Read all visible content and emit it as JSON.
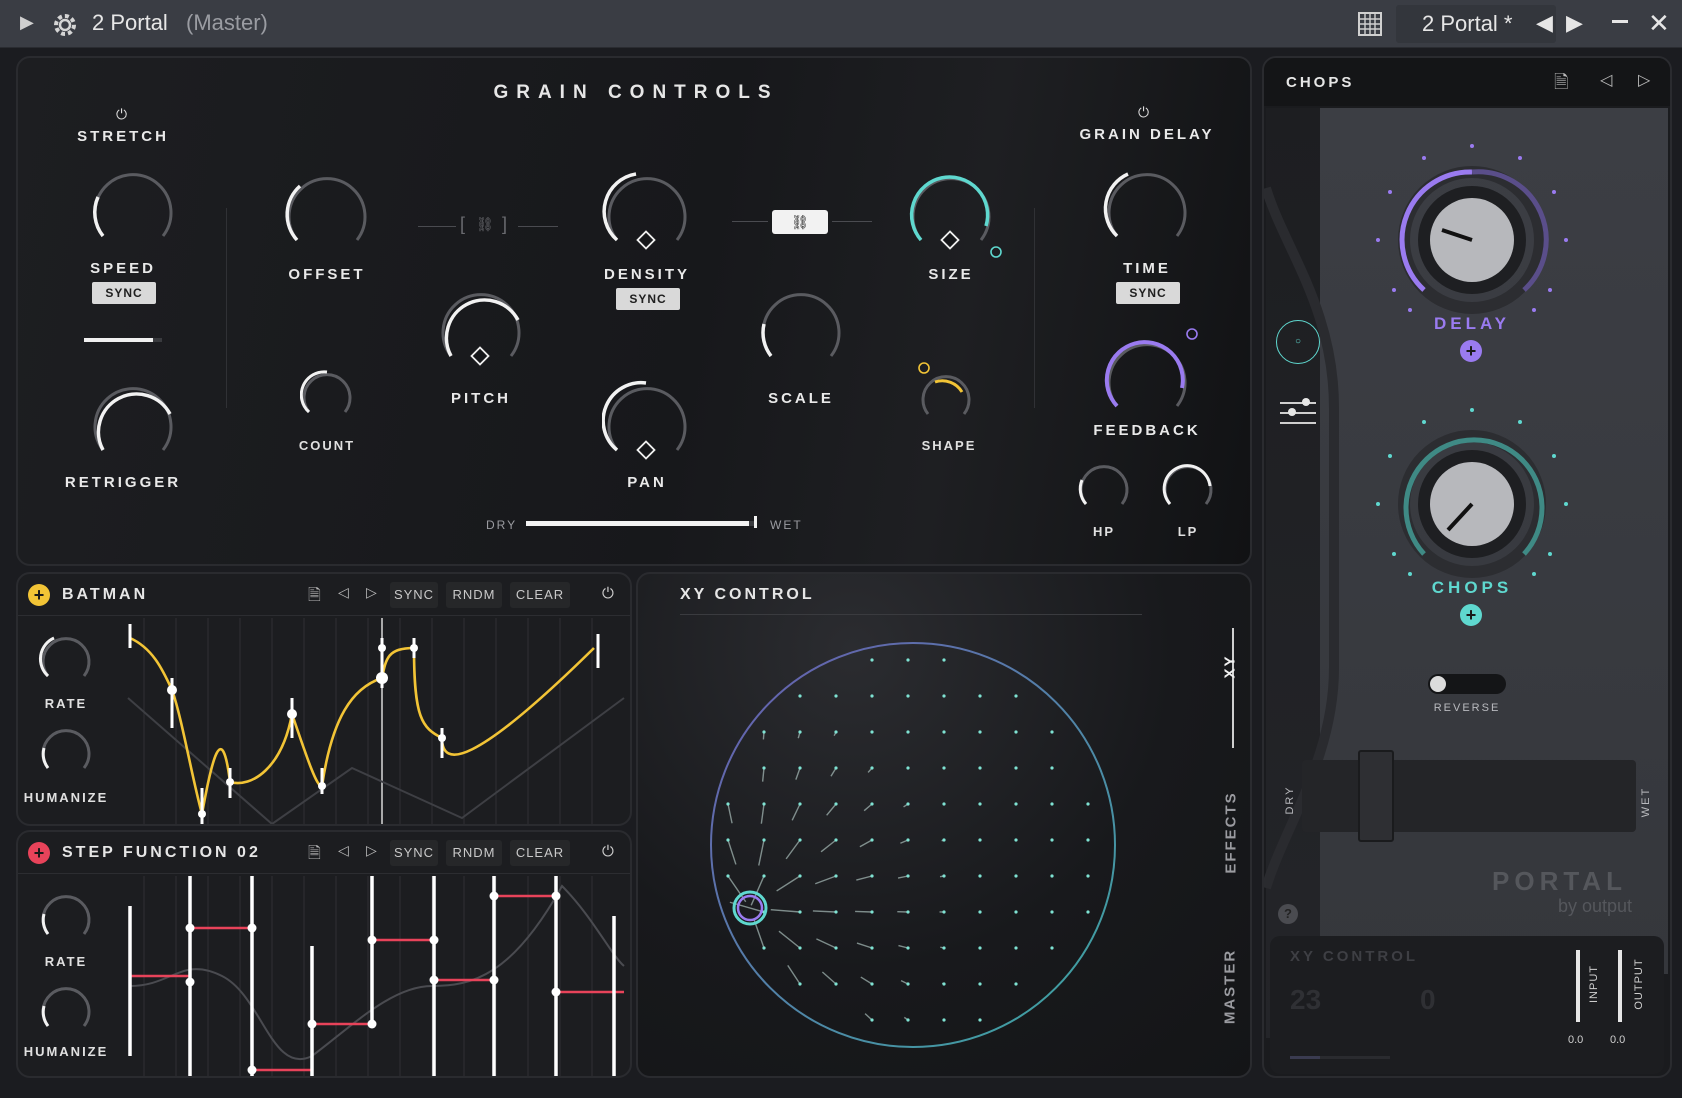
{
  "titlebar": {
    "plugin_name": "2 Portal",
    "plugin_context": "(Master)",
    "preset_name": "2 Portal *",
    "icons": [
      "arrow-right-icon",
      "gear-icon",
      "grid-icon",
      "chevron-left-icon",
      "chevron-right-icon",
      "minimize-icon",
      "close-icon"
    ]
  },
  "grain_controls": {
    "title": "GRAIN CONTROLS",
    "stretch_label": "STRETCH",
    "speed_label": "SPEED",
    "speed_sync": "SYNC",
    "retrigger_label": "RETRIGGER",
    "offset_label": "OFFSET",
    "count_label": "COUNT",
    "pitch_label": "PITCH",
    "density_label": "DENSITY",
    "density_sync": "SYNC",
    "pan_label": "PAN",
    "scale_label": "SCALE",
    "size_label": "SIZE",
    "shape_label": "SHAPE",
    "grain_delay_label": "GRAIN DELAY",
    "time_label": "TIME",
    "time_sync": "SYNC",
    "feedback_label": "FEEDBACK",
    "hp_label": "HP",
    "lp_label": "LP",
    "dry_label": "DRY",
    "wet_label": "WET",
    "dry_wet_value": 0.98
  },
  "modulators": [
    {
      "name": "BATMAN",
      "color": "#f2c436",
      "sync": "SYNC",
      "rndm": "RNDM",
      "clear": "CLEAR",
      "rate_label": "RATE",
      "humanize_label": "HUMANIZE"
    },
    {
      "name": "STEP FUNCTION 02",
      "color": "#e8435a",
      "sync": "SYNC",
      "rndm": "RNDM",
      "clear": "CLEAR",
      "rate_label": "RATE",
      "humanize_label": "HUMANIZE"
    }
  ],
  "xy": {
    "title": "XY CONTROL",
    "tabs": [
      "XY",
      "EFFECTS",
      "MASTER"
    ],
    "active_tab": "XY"
  },
  "chops": {
    "title": "CHOPS",
    "delay_label": "DELAY",
    "chops_label": "CHOPS",
    "reverse_label": "REVERSE",
    "dry_label": "DRY",
    "wet_label": "WET",
    "delay_color": "#9a7bf0",
    "chops_color": "#5fd8cf",
    "brand": "PORTAL",
    "brand_sub": "by output"
  },
  "bottom_panel": {
    "title": "XY CONTROL",
    "value_a": "23",
    "value_b": "0",
    "input_label": "INPUT",
    "output_label": "OUTPUT",
    "input_value": "0.0",
    "output_value": "0.0"
  }
}
